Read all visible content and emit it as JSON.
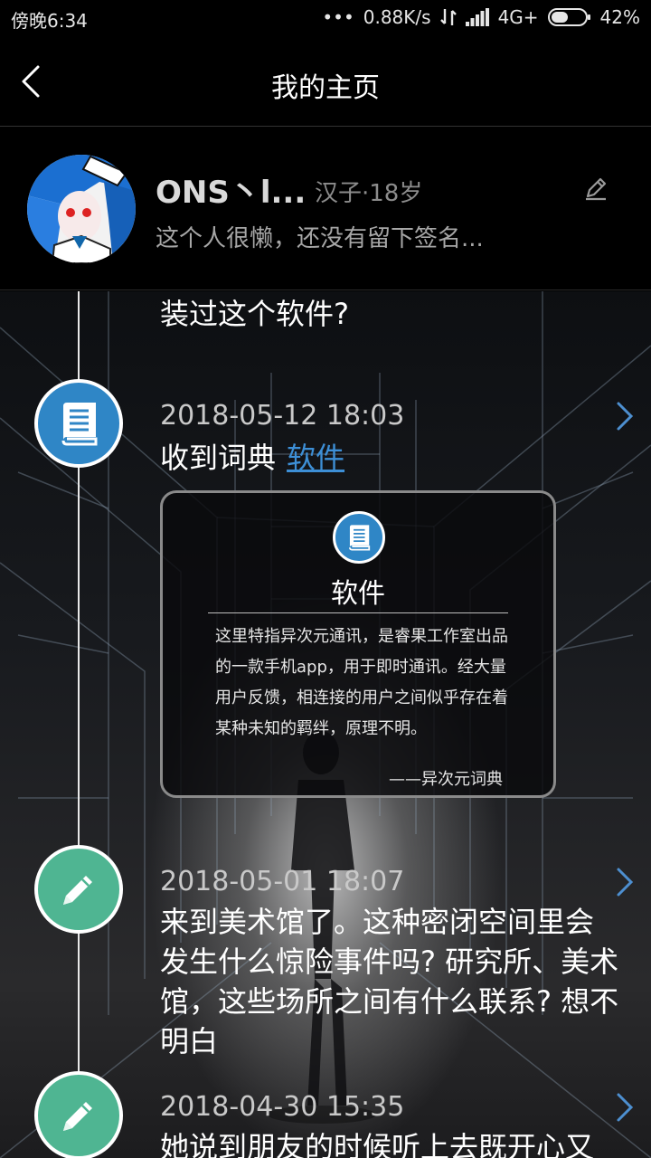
{
  "status_bar": {
    "time": "傍晚6:34",
    "network_speed": "0.88K/s",
    "network_type": "4G+",
    "battery": "42%"
  },
  "header": {
    "title": "我的主页",
    "back_icon": "chevron-left-icon"
  },
  "profile": {
    "nickname": "ONS丶l...",
    "meta": "汉子·18岁",
    "signature": "这个人很懒，还没有留下签名...",
    "edit_icon": "pencil-icon"
  },
  "timeline": {
    "previous_tail": "装过这个软件?",
    "entries": [
      {
        "date": "2018-05-12 18:03",
        "text": "收到词典",
        "link": "软件",
        "icon": "book-icon",
        "color": "#2f86c6",
        "card": {
          "title": "软件",
          "description": "这里特指异次元通讯，是睿果工作室出品的一款手机app，用于即时通讯。经大量用户反馈，相连接的用户之间似乎存在着某种未知的羁绊，原理不明。",
          "source": "——异次元词典"
        }
      },
      {
        "date": "2018-05-01 18:07",
        "text": "来到美术馆了。这种密闭空间里会发生什么惊险事件吗? 研究所、美术馆，这些场所之间有什么联系? 想不明白",
        "icon": "pencil-icon",
        "color": "#4fb592"
      },
      {
        "date": "2018-04-30 15:35",
        "text": "她说到朋友的时候听上去既开心又",
        "icon": "pencil-icon",
        "color": "#4fb592"
      }
    ]
  }
}
